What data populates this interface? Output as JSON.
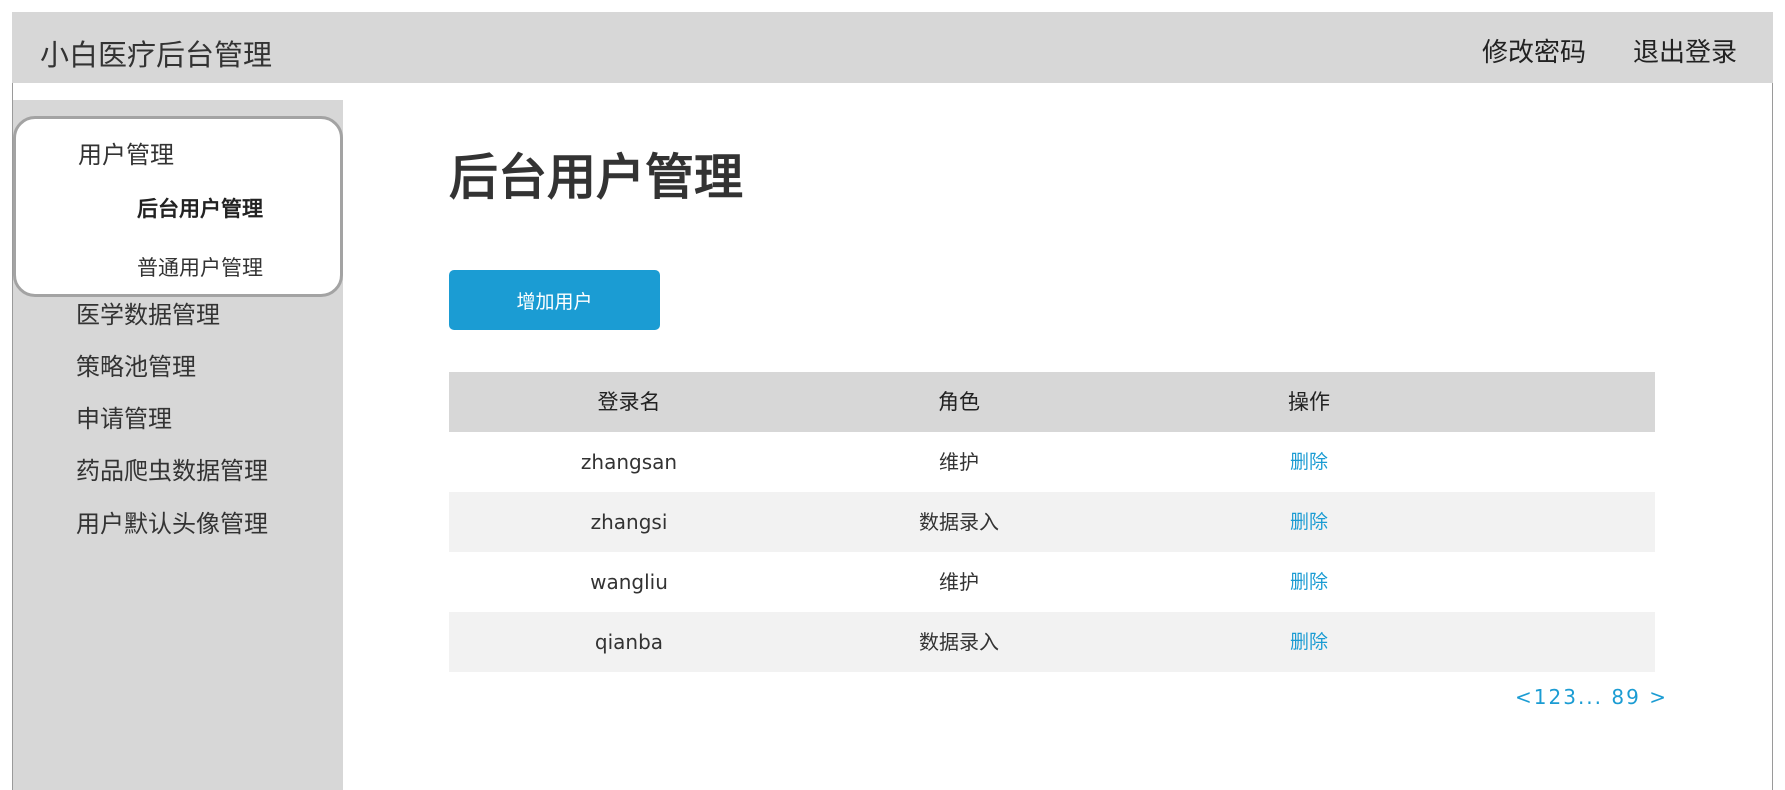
{
  "header": {
    "app_title": "小白医疗后台管理",
    "change_password": "修改密码",
    "logout": "退出登录"
  },
  "sidebar": {
    "group": {
      "title": "用户管理",
      "items": [
        {
          "label": "后台用户管理",
          "active": true
        },
        {
          "label": "普通用户管理",
          "active": false
        }
      ]
    },
    "items": [
      {
        "label": "医学数据管理"
      },
      {
        "label": "策略池管理"
      },
      {
        "label": "申请管理"
      },
      {
        "label": "药品爬虫数据管理"
      },
      {
        "label": "用户默认头像管理"
      }
    ]
  },
  "main": {
    "title": "后台用户管理",
    "add_button": "增加用户",
    "table": {
      "columns": [
        "登录名",
        "角色",
        "操作"
      ],
      "rows": [
        {
          "login": "zhangsan",
          "role": "维护",
          "action": "删除"
        },
        {
          "login": "zhangsi",
          "role": "数据录入",
          "action": "删除"
        },
        {
          "login": "wangliu",
          "role": "维护",
          "action": "删除"
        },
        {
          "login": "qianba",
          "role": "数据录入",
          "action": "删除"
        }
      ]
    },
    "pagination": {
      "prev": "<",
      "pages": "123",
      "ellipsis": "...",
      "tail": "89",
      "next": ">"
    }
  },
  "colors": {
    "accent": "#1b9cd3",
    "topbar_bg": "#d7d7d7",
    "sidebar_bg": "#d7d7d7",
    "row_alt_bg": "#f2f2f2"
  }
}
